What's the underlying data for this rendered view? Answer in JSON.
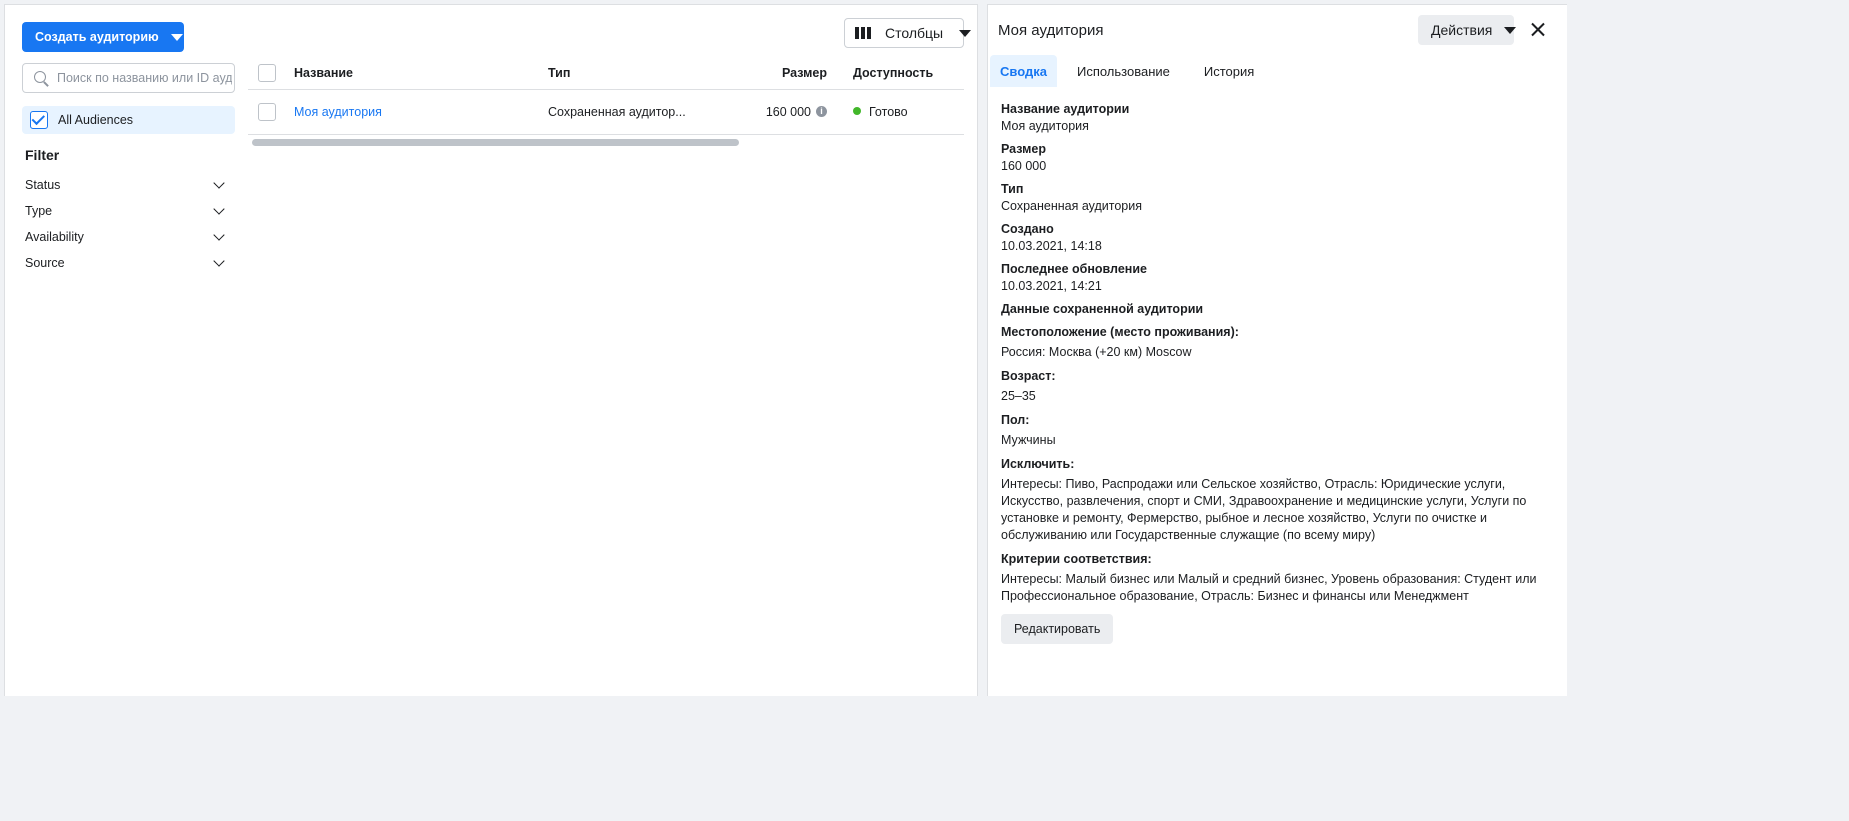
{
  "toolbar": {
    "create_label": "Создать аудиторию",
    "columns_label": "Столбцы"
  },
  "sidebar": {
    "search_placeholder": "Поиск по названию или ID ауд...",
    "all_audiences": "All Audiences",
    "filter_title": "Filter",
    "filters": [
      "Status",
      "Type",
      "Availability",
      "Source"
    ]
  },
  "table": {
    "headers": {
      "name": "Название",
      "type": "Тип",
      "size": "Размер",
      "availability": "Доступность"
    },
    "rows": [
      {
        "name": "Моя аудитория",
        "type": "Сохраненная аудитор...",
        "size": "160 000",
        "availability": "Готово"
      }
    ]
  },
  "detail": {
    "title": "Моя аудитория",
    "actions_label": "Действия",
    "tabs": [
      "Сводка",
      "Использование",
      "История"
    ],
    "active_tab": 0,
    "fields": [
      {
        "label": "Название аудитории",
        "value": "Моя аудитория"
      },
      {
        "label": "Размер",
        "value": "160 000"
      },
      {
        "label": "Тип",
        "value": "Сохраненная аудитория"
      },
      {
        "label": "Создано",
        "value": "10.03.2021, 14:18"
      },
      {
        "label": "Последнее обновление",
        "value": "10.03.2021, 14:21"
      }
    ],
    "saved_section_title": "Данные сохраненной аудитории",
    "criteria": [
      {
        "label": "Местоположение (место проживания):",
        "value": "Россия: Москва (+20 км) Moscow"
      },
      {
        "label": "Возраст:",
        "value": "25–35"
      },
      {
        "label": "Пол:",
        "value": "Мужчины"
      },
      {
        "label": "Исключить:",
        "value": "Интересы: Пиво, Распродажи или Сельское хозяйство, Отрасль: Юридические услуги, Искусство, развлечения, спорт и СМИ, Здравоохранение и медицинские услуги, Услуги по установке и ремонту, Фермерство, рыбное и лесное хозяйство, Услуги по очистке и обслуживанию или Государственные служащие (по всему миру)"
      },
      {
        "label": "Критерии соответствия:",
        "value": "Интересы: Малый бизнес или Малый и средний бизнес, Уровень образования: Студент или Профессиональное образование, Отрасль: Бизнес и финансы или Менеджмент"
      }
    ],
    "edit_label": "Редактировать"
  },
  "colors": {
    "accent": "#1877f2",
    "ready": "#42b72a"
  },
  "icons": [
    "caret-down-icon",
    "columns-icon",
    "search-icon",
    "check-icon",
    "chevron-down-icon",
    "info-icon",
    "close-icon"
  ]
}
